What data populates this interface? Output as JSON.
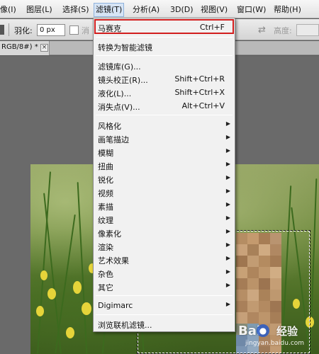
{
  "menubar": {
    "items": [
      {
        "label": "像(I)",
        "active": false
      },
      {
        "label": "图层(L)",
        "active": false
      },
      {
        "label": "选择(S)",
        "active": false
      },
      {
        "label": "滤镜(T)",
        "active": true
      },
      {
        "label": "分析(A)",
        "active": false
      },
      {
        "label": "3D(D)",
        "active": false
      },
      {
        "label": "视图(V)",
        "active": false
      },
      {
        "label": "窗口(W)",
        "active": false
      },
      {
        "label": "帮助(H)",
        "active": false
      }
    ]
  },
  "options_bar": {
    "feather_label": "羽化:",
    "feather_value": "0 px",
    "antialias_label": "消",
    "height_label": "高度:"
  },
  "document_tab": {
    "label": "RGB/8#) *",
    "close": "×"
  },
  "filter_menu": {
    "top_items": [
      {
        "label": "马赛克",
        "shortcut": "Ctrl+F"
      },
      {
        "label": "转换为智能滤镜",
        "shortcut": ""
      }
    ],
    "group_two": [
      {
        "label": "滤镜库(G)...",
        "shortcut": ""
      },
      {
        "label": "镜头校正(R)...",
        "shortcut": "Shift+Ctrl+R"
      },
      {
        "label": "液化(L)...",
        "shortcut": "Shift+Ctrl+X"
      },
      {
        "label": "消失点(V)...",
        "shortcut": "Alt+Ctrl+V"
      }
    ],
    "submenus": [
      {
        "label": "风格化"
      },
      {
        "label": "画笔描边"
      },
      {
        "label": "模糊"
      },
      {
        "label": "扭曲"
      },
      {
        "label": "锐化"
      },
      {
        "label": "视频"
      },
      {
        "label": "素描"
      },
      {
        "label": "纹理"
      },
      {
        "label": "像素化"
      },
      {
        "label": "渲染"
      },
      {
        "label": "艺术效果"
      },
      {
        "label": "杂色"
      },
      {
        "label": "其它"
      }
    ],
    "digimarc": {
      "label": "Digimarc"
    },
    "browse_online": {
      "label": "浏览联机滤镜..."
    }
  },
  "watermark": {
    "logo_text": "Bai",
    "logo_suffix": "经验",
    "url": "jingyan.baidu.com"
  },
  "colors": {
    "highlight_box": "#d21e1e",
    "menu_bg": "#f1f1f1",
    "active_menu": "#d6e4f5"
  }
}
